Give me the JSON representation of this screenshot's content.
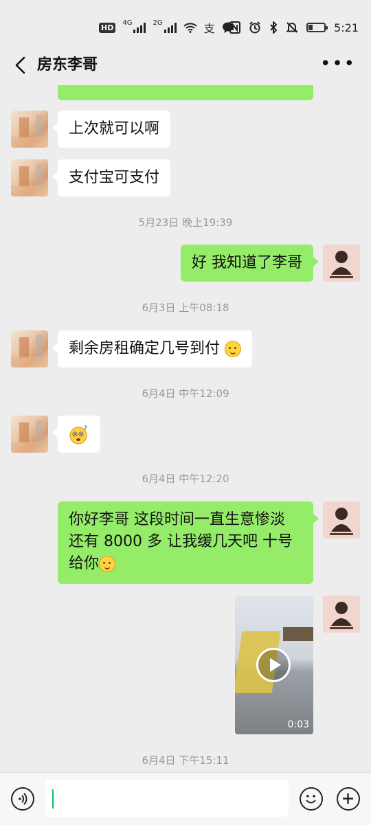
{
  "status_bar": {
    "left_badge": "HD",
    "net1": "4G",
    "net2": "2G",
    "time": "5:21"
  },
  "nav": {
    "title": "房东李哥"
  },
  "messages": {
    "m1": "上次就可以啊",
    "m2": "支付宝可支付",
    "ts1": "5月23日 晚上19:39",
    "m3": "好 我知道了李哥",
    "ts2": "6月3日 上午08:18",
    "m4": "剩余房租确定几号到付",
    "ts3": "6月4日 中午12:09",
    "ts4": "6月4日 中午12:20",
    "m6_line1": "你好李哥  这段时间一直生意惨淡",
    "m6_line2": "还有 8000 多  让我缓几天吧   十号",
    "m6_line3": "给你",
    "video_duration": "0:03",
    "ts5": "6月4日 下午15:11"
  },
  "input": {
    "value": ""
  }
}
